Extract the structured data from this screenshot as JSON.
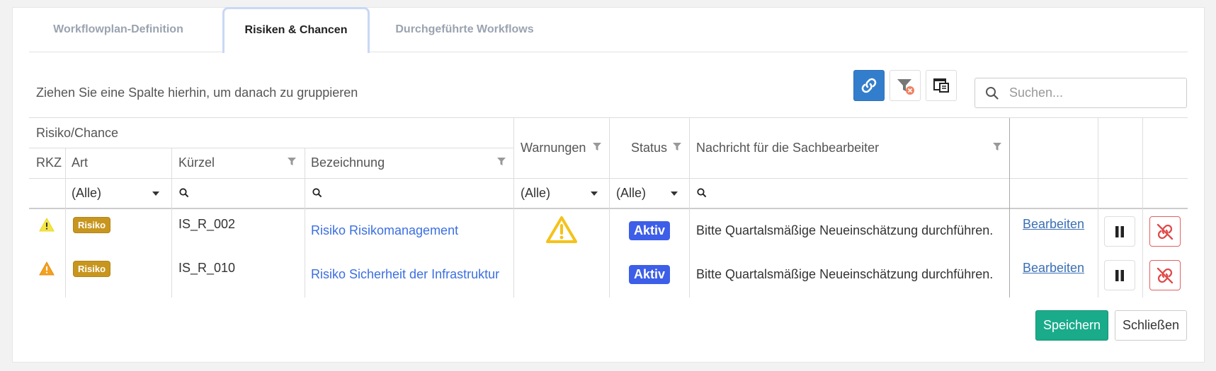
{
  "tabs": [
    {
      "label": "Workflowplan-Definition",
      "active": false
    },
    {
      "label": "Risiken & Chancen",
      "active": true
    },
    {
      "label": "Durchgeführte Workflows",
      "active": false
    }
  ],
  "toolbar": {
    "group_hint": "Ziehen Sie eine Spalte hierhin, um danach zu gruppieren",
    "search_placeholder": "Suchen...",
    "icons": [
      "link-icon",
      "clear-filter-icon",
      "column-chooser-icon"
    ]
  },
  "grid": {
    "band_header": "Risiko/Chance",
    "columns": {
      "rkz": "RKZ",
      "art": "Art",
      "kuerzel": "Kürzel",
      "bezeichnung": "Bezeichnung",
      "warnungen": "Warnungen",
      "status": "Status",
      "nachricht": "Nachricht für die Sachbearbeiter"
    },
    "filters": {
      "art": "(Alle)",
      "warnungen": "(Alle)",
      "status": "(Alle)"
    },
    "rows": [
      {
        "rkz_icon": "warning-yellow-icon",
        "art": "Risiko",
        "kuerzel": "IS_R_002",
        "bezeichnung": "Risiko Risikomanagement",
        "warnung_icon": "warning-icon",
        "status": "Aktiv",
        "nachricht": "Bitte Quartalsmäßige Neueinschätzung durchführen.",
        "edit": "Bearbeiten"
      },
      {
        "rkz_icon": "warning-orange-icon",
        "art": "Risiko",
        "kuerzel": "IS_R_010",
        "bezeichnung": "Risiko Sicherheit der Infrastruktur",
        "warnung_icon": "",
        "status": "Aktiv",
        "nachricht": "Bitte Quartalsmäßige Neueinschätzung durchführen.",
        "edit": "Bearbeiten"
      }
    ]
  },
  "footer": {
    "save": "Speichern",
    "close": "Schließen"
  },
  "colors": {
    "accent": "#337ecc",
    "save": "#1aab8b",
    "risk_badge": "#c8961e",
    "status_badge": "#3d5ee8",
    "link": "#3b6fe0"
  }
}
